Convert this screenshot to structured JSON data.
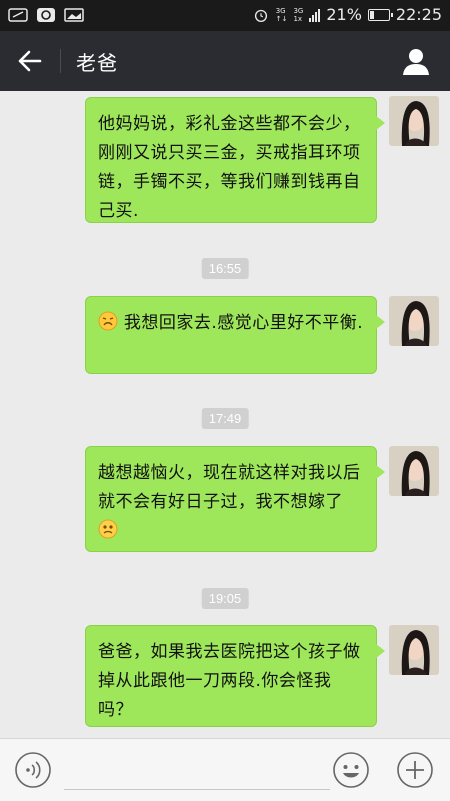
{
  "status_bar": {
    "network_1": "3G",
    "network_2": "3G",
    "network_suffix": "1x",
    "battery": "21%",
    "time": "22:25"
  },
  "header": {
    "title": "老爸"
  },
  "messages": [
    {
      "text": "他妈妈说，彩礼金这些都不会少，刚刚又说只买三金，买戒指耳环项链，手镯不买，等我们赚到钱再自己买."
    },
    {
      "time": "16:55",
      "text": "我想回家去.感觉心里好不平衡."
    },
    {
      "time": "17:49",
      "text": "越想越恼火，现在就这样对我以后就不会有好日子过，我不想嫁了"
    },
    {
      "time": "19:05",
      "text": "爸爸，如果我去医院把这个孩子做掉从此跟他一刀两段.你会怪我吗？"
    }
  ],
  "input_bar": {
    "placeholder": ""
  },
  "colors": {
    "bubble": "#9fe75a",
    "header": "#2a2c31",
    "background": "#ebebeb"
  }
}
